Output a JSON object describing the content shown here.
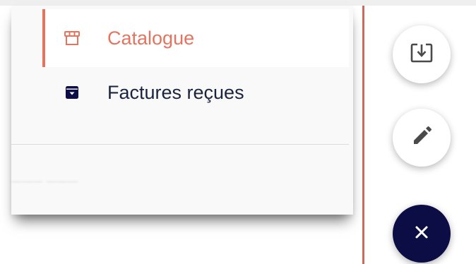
{
  "menu": {
    "items": [
      {
        "label": "Catalogue",
        "icon": "storefront-icon",
        "active": true
      },
      {
        "label": "Factures reçues",
        "icon": "archive-box-icon",
        "active": false
      }
    ],
    "faded_footer_text": "——— ———"
  },
  "fab": {
    "download_icon": "download-box-icon",
    "edit_icon": "pencil-icon",
    "close_icon": "close-icon"
  },
  "colors": {
    "accent": "#e5745f",
    "text_dark": "#1a2440",
    "fab_dark": "#0d0d45",
    "divider_line": "#c96a5c"
  }
}
